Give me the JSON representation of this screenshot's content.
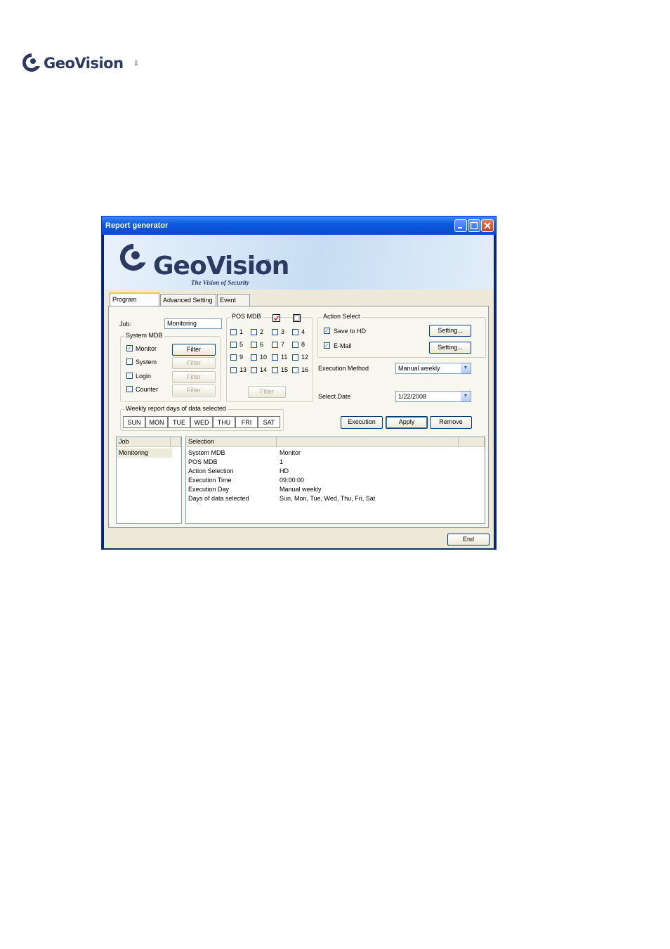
{
  "page": {
    "logo_text": "GeoVision",
    "logo_inc": "inc"
  },
  "window": {
    "title": "Report generator"
  },
  "banner": {
    "brand": "GeoVision",
    "inc": "inc",
    "tagline": "The Vision of Security"
  },
  "tabs": [
    {
      "label": "Program Report"
    },
    {
      "label": "Advanced Setting"
    },
    {
      "label": "Event Log"
    }
  ],
  "job": {
    "label": "Job:",
    "value": "Monitoring"
  },
  "system_mdb": {
    "title": "System MDB",
    "items": [
      {
        "label": "Monitor",
        "checked": true,
        "filter": "Filter"
      },
      {
        "label": "System",
        "checked": false,
        "filter": "Filter"
      },
      {
        "label": "Login",
        "checked": false,
        "filter": "Filter"
      },
      {
        "label": "Counter",
        "checked": false,
        "filter": "Filter"
      }
    ]
  },
  "pos_mdb": {
    "title": "POS MDB",
    "channels": [
      "1",
      "2",
      "3",
      "4",
      "5",
      "6",
      "7",
      "8",
      "9",
      "10",
      "11",
      "12",
      "13",
      "14",
      "15",
      "16"
    ],
    "filter": "Filter"
  },
  "action_select": {
    "title": "Action Select",
    "save_hd": {
      "label": "Save to HD",
      "checked": true,
      "button": "Setting..."
    },
    "email": {
      "label": "E-Mail",
      "checked": true,
      "button": "Setting..."
    }
  },
  "execution_method": {
    "label": "Execution Method",
    "value": "Manual weekly"
  },
  "select_date": {
    "label": "Select Date",
    "value": "1/22/2008"
  },
  "weekly": {
    "title": "Weekly report days of data selected",
    "days": [
      "SUN",
      "MON",
      "TUE",
      "WED",
      "THU",
      "FRI",
      "SAT"
    ]
  },
  "actions": {
    "execution": "Execution",
    "apply": "Apply",
    "remove": "Remove"
  },
  "job_list": {
    "header": "Job",
    "items": [
      "Monitoring"
    ]
  },
  "selection_table": {
    "header": "Selection",
    "rows": [
      {
        "key": "System MDB",
        "value": "Monitor"
      },
      {
        "key": "POS MDB",
        "value": "1"
      },
      {
        "key": "Action Selection",
        "value": "HD"
      },
      {
        "key": "Execution Time",
        "value": "09:00:00"
      },
      {
        "key": "Execution Day",
        "value": "Manual weekly"
      },
      {
        "key": "Days of data selected",
        "value": "Sun, Mon, Tue, Wed, Thu, Fri, Sat"
      }
    ]
  },
  "footer": {
    "end": "End"
  },
  "colors": {
    "title_bar": "#0a4bd0",
    "brand": "#2c3a60",
    "window_bg": "#ece9d8"
  }
}
